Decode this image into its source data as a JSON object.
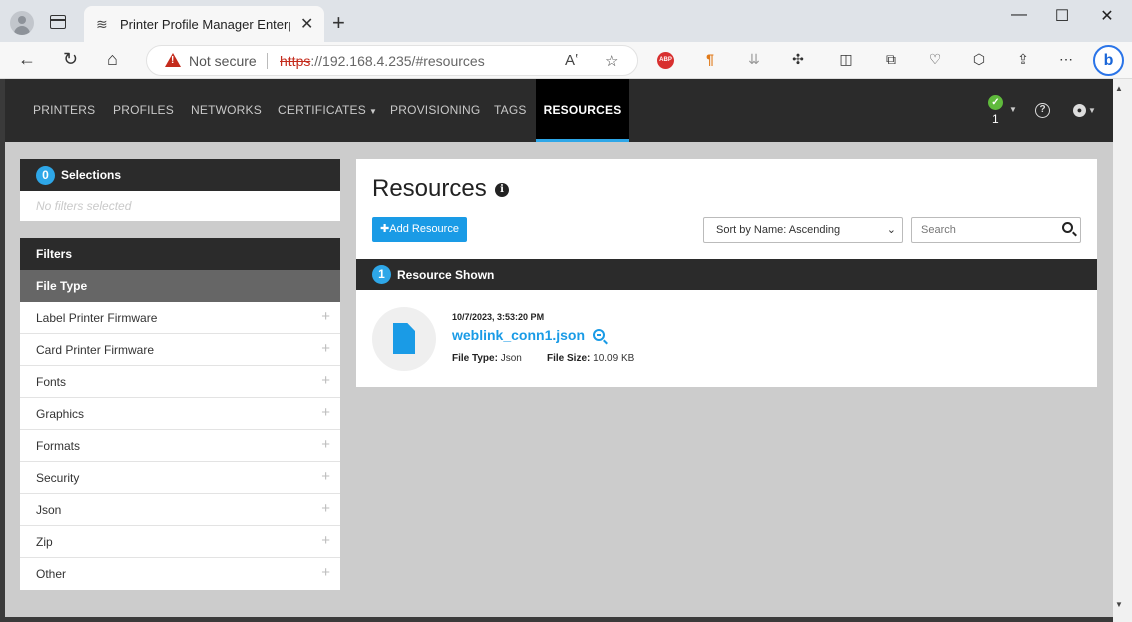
{
  "browser": {
    "tab_title": "Printer Profile Manager Enterprise",
    "tab_close": "✕",
    "new_tab": "+",
    "window_controls": {
      "minimize": "—",
      "maximize": "☐",
      "close": "✕"
    },
    "not_secure": "Not secure",
    "url_protocol": "https",
    "url_rest": "://192.168.4.235/#resources",
    "read_aloud_icon": "Aʽ",
    "favorite_icon": "☆",
    "abp_label": "ABP",
    "bing_label": "b"
  },
  "nav": {
    "items": [
      {
        "label": "PRINTERS"
      },
      {
        "label": "PROFILES"
      },
      {
        "label": "NETWORKS"
      },
      {
        "label": "CERTIFICATES"
      },
      {
        "label": "PROVISIONING"
      },
      {
        "label": "TAGS"
      },
      {
        "label": "RESOURCES"
      }
    ],
    "status_count": "1"
  },
  "selections": {
    "count": "0",
    "title": "Selections",
    "empty_text": "No filters selected"
  },
  "filters": {
    "title": "Filters",
    "file_type_header": "File Type",
    "items": [
      {
        "label": "Label Printer Firmware"
      },
      {
        "label": "Card Printer Firmware"
      },
      {
        "label": "Fonts"
      },
      {
        "label": "Graphics"
      },
      {
        "label": "Formats"
      },
      {
        "label": "Security"
      },
      {
        "label": "Json"
      },
      {
        "label": "Zip"
      },
      {
        "label": "Other"
      }
    ]
  },
  "main": {
    "title": "Resources",
    "add_button": "Add Resource",
    "sort_value": "Sort by Name: Ascending",
    "search_placeholder": "Search",
    "shown_count": "1",
    "shown_label": "Resource Shown",
    "resource": {
      "date": "10/7/2023, 3:53:20 PM",
      "name": "weblink_conn1.json",
      "file_type_label": "File Type:",
      "file_type": "Json",
      "file_size_label": "File Size:",
      "file_size": "10.09 KB"
    }
  },
  "colors": {
    "accent": "#1a9be6",
    "nav_bg": "#2b2b2b",
    "active_bg": "#000000",
    "status_green": "#5fba3c",
    "warning_red": "#c42b1c"
  }
}
